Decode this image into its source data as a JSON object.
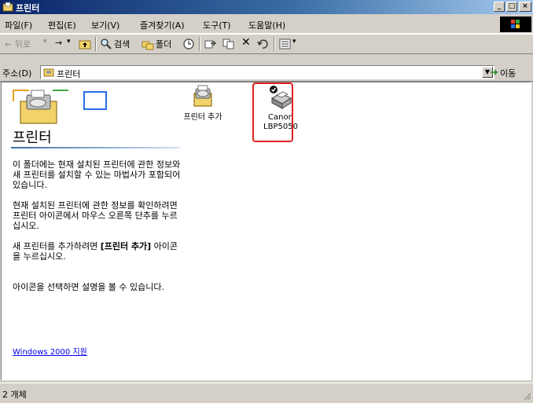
{
  "window": {
    "title": "프린터"
  },
  "menu": {
    "items": [
      "파일(F)",
      "편집(E)",
      "보기(V)",
      "즐겨찾기(A)",
      "도구(T)",
      "도움말(H)"
    ]
  },
  "toolbar": {
    "back": "← 뒤로",
    "forward": "→",
    "search": "검색",
    "folders": "폴더",
    "history": "☉"
  },
  "address": {
    "label": "주소(D)",
    "value": "프린터",
    "go": "이동"
  },
  "left_panel": {
    "title": "프린터",
    "paragraph1": "이 폴더에는 현재 설치된 프린터에 관한 정보와 새 프린터를 설치할 수 있는 마법사가 포함되어 있습니다.",
    "paragraph2": "현재 설치된 프린터에 관한 정보를 확인하려면 프린터 아이콘에서 마우스 오른쪽 단추를 누르십시오.",
    "paragraph3_prefix": "새 프린터를 추가하려면 ",
    "paragraph3_bold": "[프린터 추가]",
    "paragraph3_suffix": " 아이콘을 누르십시오.",
    "paragraph4": "아이콘을 선택하면 설명을 볼 수 있습니다.",
    "link": "Windows 2000 지원"
  },
  "icons": [
    {
      "label": "프린터 추가"
    },
    {
      "label": "Canon LBP5050"
    }
  ],
  "status": {
    "text": "2 개체"
  }
}
